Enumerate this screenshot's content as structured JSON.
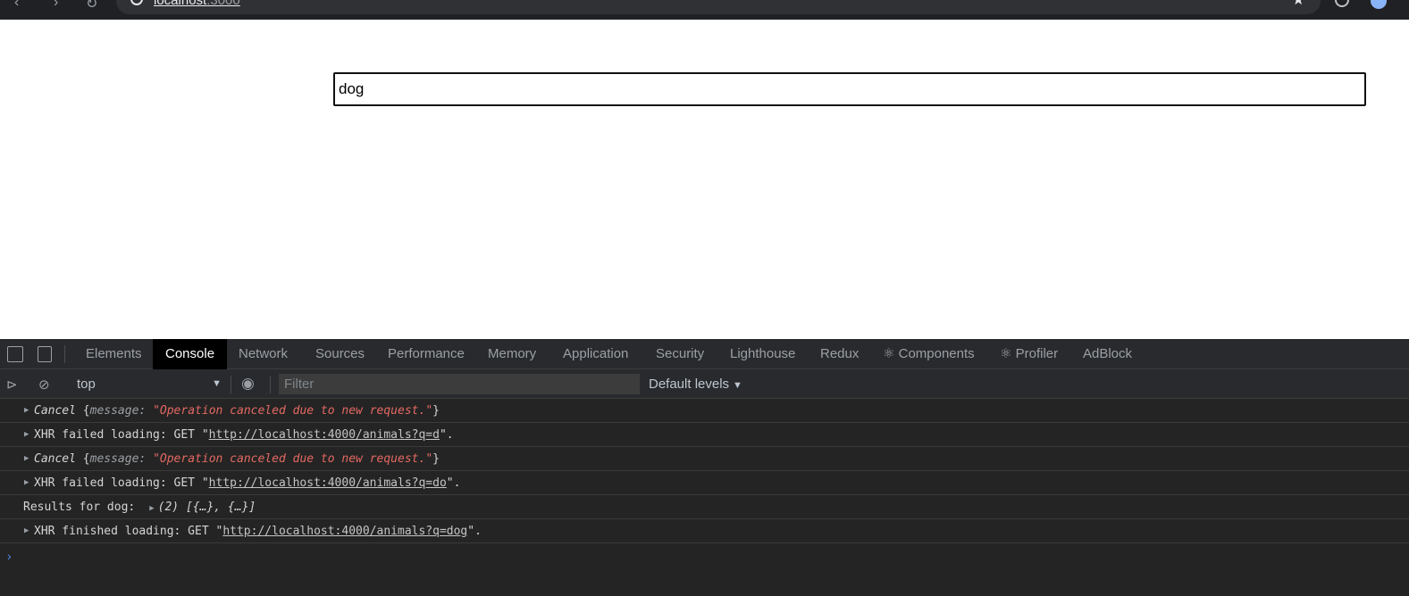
{
  "browser": {
    "url_host": "localhost",
    "url_port": ":3000"
  },
  "page": {
    "search": {
      "value": "dog"
    }
  },
  "devtools": {
    "tabs": [
      {
        "label": "Elements"
      },
      {
        "label": "Console",
        "active": true
      },
      {
        "label": "Network"
      },
      {
        "label": "Sources"
      },
      {
        "label": "Performance"
      },
      {
        "label": "Memory"
      },
      {
        "label": "Application"
      },
      {
        "label": "Security"
      },
      {
        "label": "Lighthouse"
      },
      {
        "label": "Redux"
      },
      {
        "label": "⚛ Components"
      },
      {
        "label": "⚛ Profiler"
      },
      {
        "label": "AdBlock"
      }
    ],
    "toolbar": {
      "context": "top",
      "filter_placeholder": "Filter",
      "levels": "Default levels"
    },
    "console": {
      "lines": [
        {
          "type": "cancel",
          "name": "Cancel",
          "open": "{",
          "key": "message",
          "colon": ": ",
          "value": "\"Operation canceled due to new request.\"",
          "close": "}"
        },
        {
          "type": "xhr",
          "prefix": "XHR failed loading: GET \"",
          "url": "http://localhost:4000/animals?q=d",
          "suffix": "\"."
        },
        {
          "type": "cancel",
          "name": "Cancel",
          "open": "{",
          "key": "message",
          "colon": ": ",
          "value": "\"Operation canceled due to new request.\"",
          "close": "}"
        },
        {
          "type": "xhr",
          "prefix": "XHR failed loading: GET \"",
          "url": "http://localhost:4000/animals?q=do",
          "suffix": "\"."
        },
        {
          "type": "results",
          "label": "Results for dog:",
          "array": "(2) [{…}, {…}]"
        },
        {
          "type": "xhr",
          "prefix": "XHR finished loading: GET \"",
          "url": "http://localhost:4000/animals?q=dog",
          "suffix": "\"."
        }
      ]
    }
  },
  "colors": {
    "devtools_bg": "#242424",
    "error_string": "#e46962",
    "prompt": "#4e8cf5"
  }
}
